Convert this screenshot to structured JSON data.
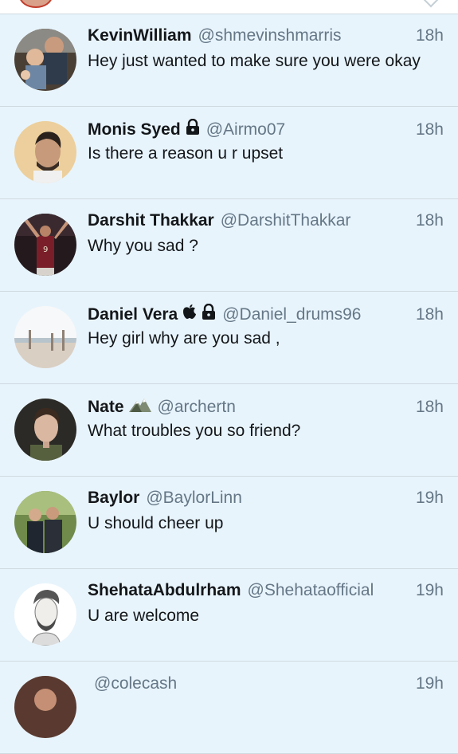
{
  "messages": [
    {
      "name": "KevinWilliam",
      "handle": "@shmevinshmarris",
      "time": "18h",
      "text": "Hey just wanted to make sure you were okay",
      "badges": []
    },
    {
      "name": "Monis Syed",
      "handle": "@Airmo07",
      "time": "18h",
      "text": "Is there a reason u r upset",
      "badges": [
        "lock-icon"
      ]
    },
    {
      "name": "Darshit Thakkar",
      "handle": "@DarshitThakkar",
      "time": "18h",
      "text": "Why you sad ?",
      "badges": []
    },
    {
      "name": "Daniel Vera",
      "handle": "@Daniel_drums96",
      "time": "18h",
      "text": "Hey girl why are you sad ,",
      "badges": [
        "apple-icon",
        "lock-icon"
      ]
    },
    {
      "name": "Nate",
      "handle": "@archertn",
      "time": "18h",
      "text": "What troubles you so friend?",
      "badges": [
        "mountain-icon"
      ]
    },
    {
      "name": "Baylor",
      "handle": "@BaylorLinn",
      "time": "19h",
      "text": "U should cheer up",
      "badges": []
    },
    {
      "name": "ShehataAbdulrham",
      "handle": "@Shehataofficial",
      "time": "19h",
      "text": "U are welcome",
      "badges": []
    },
    {
      "name": "",
      "handle": "@colecash",
      "time": "19h",
      "text": "",
      "badges": []
    }
  ],
  "colors": {
    "background": "#e8f4fc",
    "name": "#14171a",
    "secondary": "#657786",
    "divider": "#cfd9e0"
  }
}
